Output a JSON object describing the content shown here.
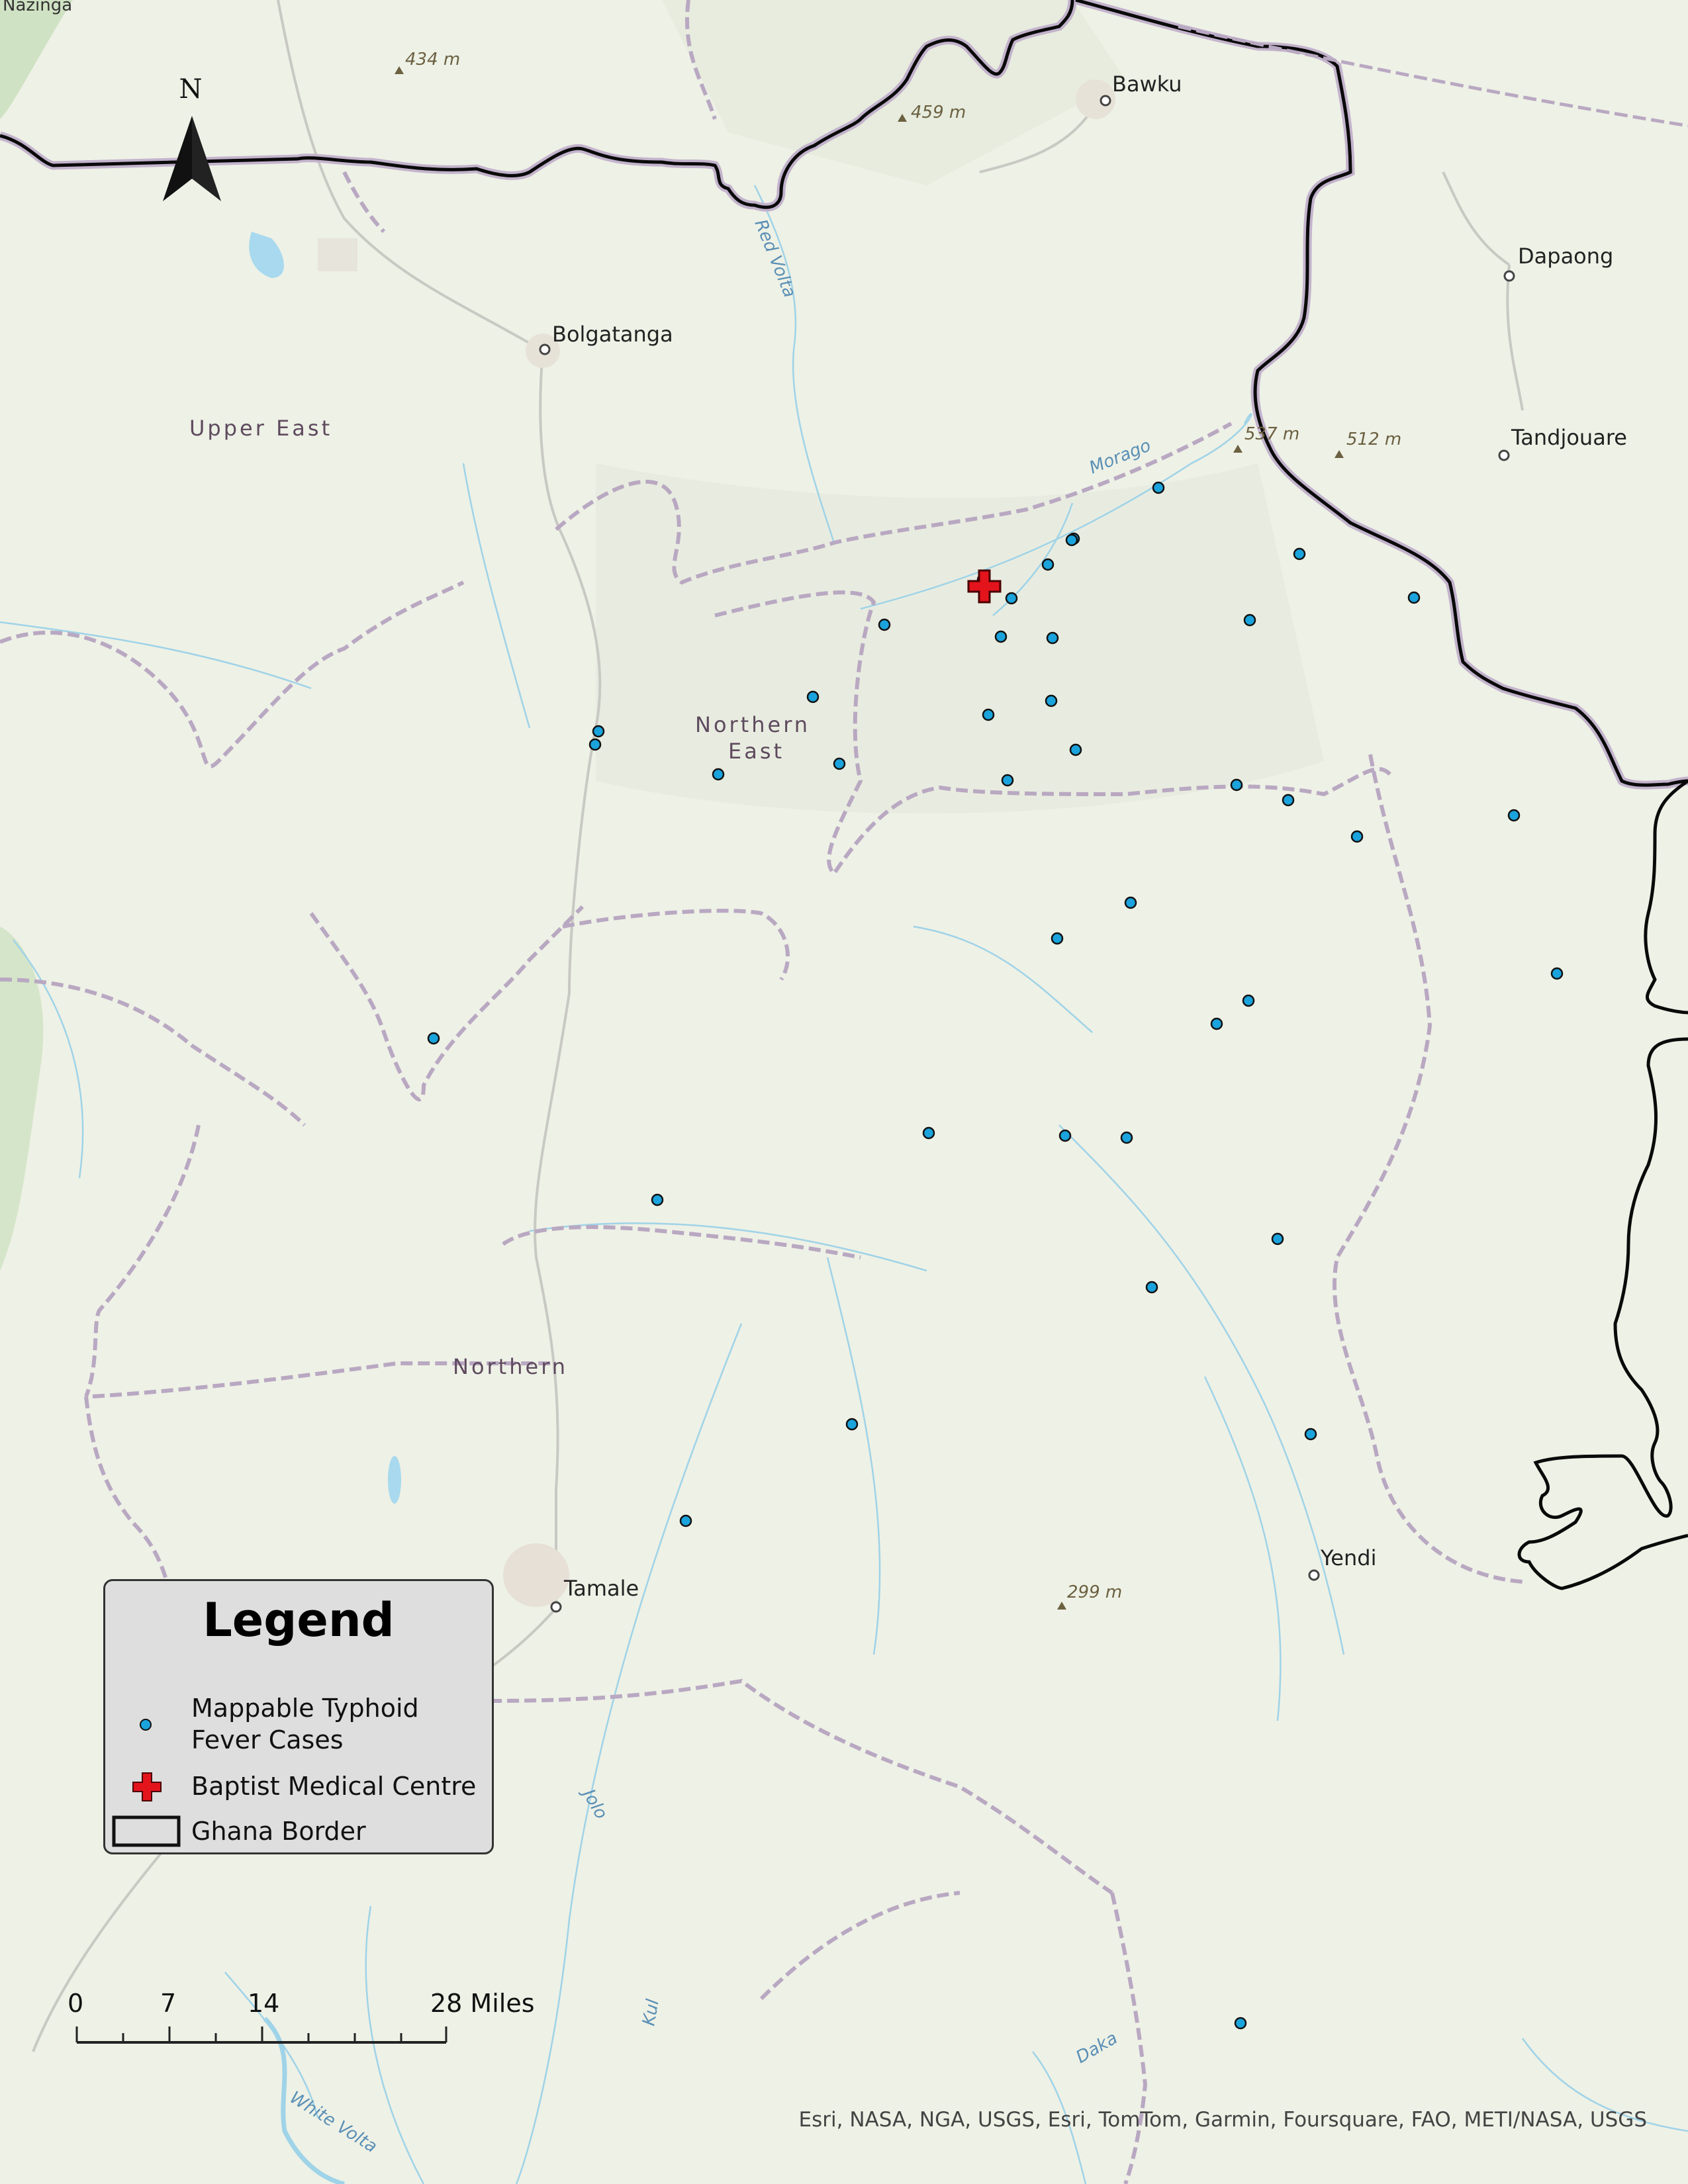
{
  "map": {
    "places": [
      {
        "name": "Nazinga",
        "id": "place-nazinga"
      },
      {
        "name": "Bawku",
        "id": "place-bawku"
      },
      {
        "name": "Dapaong",
        "id": "place-dapaong"
      },
      {
        "name": "Bolgatanga",
        "id": "place-bolgatanga"
      },
      {
        "name": "Tandjouare",
        "id": "place-tandjouare"
      },
      {
        "name": "Tamale",
        "id": "place-tamale"
      },
      {
        "name": "Yendi",
        "id": "place-yendi"
      }
    ],
    "regions": {
      "upper_east": "Upper East",
      "northern_east_line1": "Northern",
      "northern_east_line2": "East",
      "northern": "Northern"
    },
    "elevations": [
      "434 m",
      "459 m",
      "537 m",
      "512 m",
      "299 m"
    ],
    "rivers": [
      "Red Volta",
      "Morago",
      "Jolo",
      "Kul",
      "Daka",
      "White Volta"
    ],
    "north_arrow": "N",
    "attribution": "Esri, NASA, NGA, USGS, Esri, TomTom, Garmin, Foursquare, FAO, METI/NASA, USGS",
    "colors": {
      "case_fill": "#1aa3dc",
      "hospital_cross": "#e3141b",
      "border": "#000000",
      "region_boundary": "#b7a6c0",
      "river": "#8fcde6",
      "background": "#eef1e6"
    }
  },
  "legend": {
    "title": "Legend",
    "items": [
      {
        "label": "Mappable Typhoid Fever Cases",
        "icon": "case-point-icon"
      },
      {
        "label": "Baptist Medical Centre",
        "icon": "red-cross-icon"
      },
      {
        "label": "Ghana Border",
        "icon": "border-box-icon"
      }
    ]
  },
  "scale_bar": {
    "ticks": [
      "0",
      "7",
      "14",
      "28 Miles"
    ]
  }
}
